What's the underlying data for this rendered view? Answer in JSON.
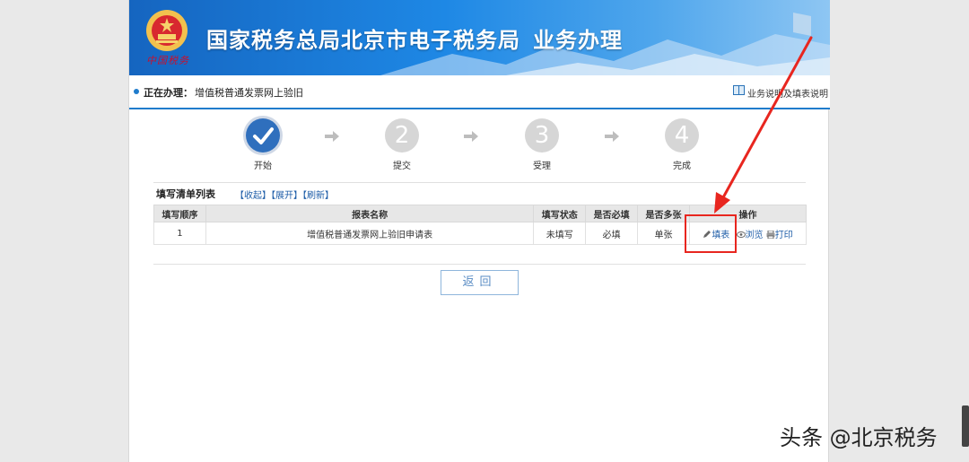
{
  "banner": {
    "motto": "中国税务",
    "title": "国家税务总局北京市电子税务局",
    "subtitle": "业务办理"
  },
  "breadcrumb": {
    "label": "正在办理：",
    "value": "增值税普通发票网上验旧",
    "help": "业务说明及填表说明"
  },
  "steps": [
    {
      "number": "✓",
      "label": "开始",
      "active": true
    },
    {
      "number": "2",
      "label": "提交",
      "active": false
    },
    {
      "number": "3",
      "label": "受理",
      "active": false
    },
    {
      "number": "4",
      "label": "完成",
      "active": false
    }
  ],
  "list": {
    "title": "填写清单列表",
    "collapse": "【收起】",
    "expand": "【展开】",
    "refresh": "【刷新】",
    "headers": [
      "填写顺序",
      "报表名称",
      "填写状态",
      "是否必填",
      "是否多张",
      "操作"
    ],
    "rows": [
      {
        "order": "1",
        "name": "增值税普通发票网上验旧申请表",
        "status": "未填写",
        "required": "必填",
        "multi": "单张",
        "fill": "填表",
        "browse": "浏览",
        "print": "打印"
      }
    ]
  },
  "back_label": "返回",
  "watermark": "头条 @北京税务",
  "colors": {
    "brand_blue": "#1f7ccc",
    "step_active": "#2f6fbd",
    "step_inactive": "#d6d6d6",
    "annotation_red": "#e8261f"
  }
}
